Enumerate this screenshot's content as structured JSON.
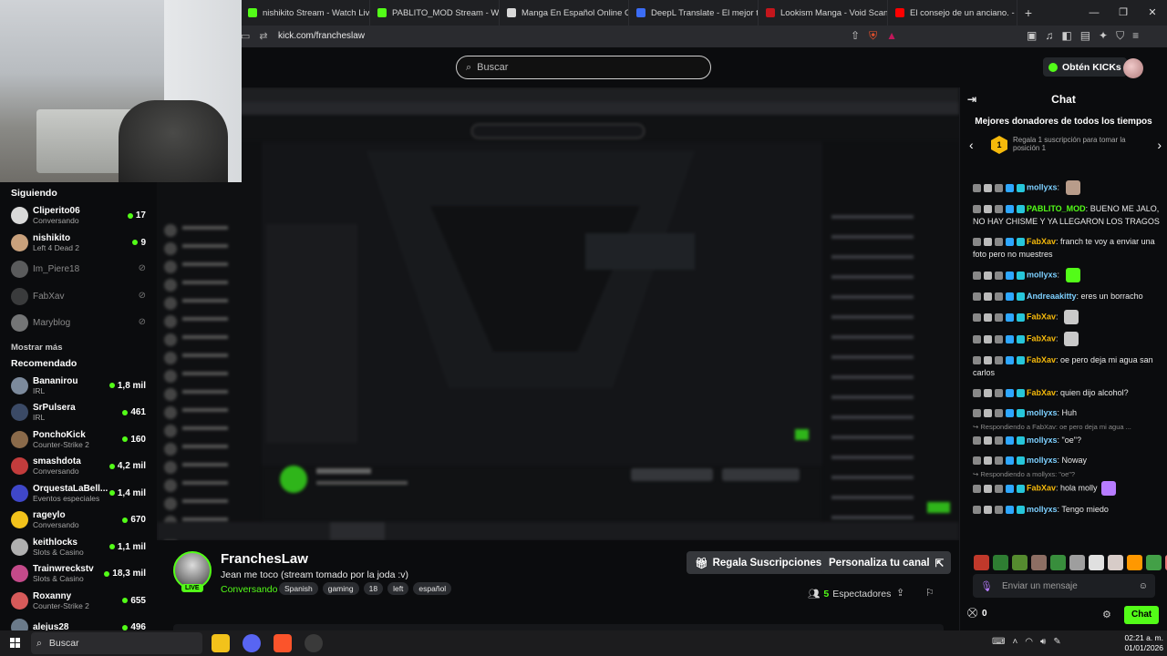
{
  "browser": {
    "tabs": [
      {
        "label": "nishikito Stream - Watch Live o",
        "color": "#53fc18"
      },
      {
        "label": "PABLITO_MOD Stream - Watch",
        "color": "#53fc18"
      },
      {
        "label": "Manga En Español Online Grat",
        "color": "#d8d8d8"
      },
      {
        "label": "DeepL Translate - El mejor trad",
        "color": "#3b6cf5"
      },
      {
        "label": "Lookism Manga - Void Scans h",
        "color": "#c4161c"
      },
      {
        "label": "El consejo de un anciano. - You",
        "color": "#ff0000"
      }
    ],
    "url": "kick.com/francheslaw"
  },
  "header": {
    "search_placeholder": "Buscar",
    "kicks_label": "Obtén KICKs"
  },
  "sidebar": {
    "following_title": "Siguiendo",
    "following": [
      {
        "name": "Cliperito06",
        "category": "Conversando",
        "viewers": "17",
        "live": true,
        "color": "#d9d9d9"
      },
      {
        "name": "nishikito",
        "category": "Left 4 Dead 2",
        "viewers": "9",
        "live": true,
        "color": "#c9a17c"
      },
      {
        "name": "Im_Piere18",
        "category": "",
        "viewers": "",
        "live": false,
        "color": "#aaaaaa"
      },
      {
        "name": "FabXav",
        "category": "",
        "viewers": "",
        "live": false,
        "color": "#6a6a6a"
      },
      {
        "name": "Maryblog",
        "category": "",
        "viewers": "",
        "live": false,
        "color": "#dddddd"
      }
    ],
    "show_more": "Mostrar más",
    "recommended_title": "Recomendado",
    "recommended": [
      {
        "name": "Bananirou",
        "category": "IRL",
        "viewers": "1,8 mil",
        "color": "#7c8a9c"
      },
      {
        "name": "SrPulsera",
        "category": "IRL",
        "viewers": "461",
        "color": "#3b4a66"
      },
      {
        "name": "PonchoKick",
        "category": "Counter-Strike 2",
        "viewers": "160",
        "color": "#8a6a4a"
      },
      {
        "name": "smashdota",
        "category": "Conversando",
        "viewers": "4,2 mil",
        "color": "#c23c3c"
      },
      {
        "name": "OrquestaLaBell...",
        "category": "Eventos especiales",
        "viewers": "1,4 mil",
        "color": "#3f47c9"
      },
      {
        "name": "rageylo",
        "category": "Conversando",
        "viewers": "670",
        "color": "#f2c21b"
      },
      {
        "name": "keithlocks",
        "category": "Slots & Casino",
        "viewers": "1,1 mil",
        "color": "#b0b0b0"
      },
      {
        "name": "Trainwreckstv",
        "category": "Slots & Casino",
        "viewers": "18,3 mil",
        "color": "#c44a8a"
      },
      {
        "name": "Roxanny",
        "category": "Counter-Strike 2",
        "viewers": "655",
        "color": "#d65a5a"
      },
      {
        "name": "alejus28",
        "category": "",
        "viewers": "496",
        "color": "#6a7a8a"
      }
    ]
  },
  "stream": {
    "name": "FranchesLaw",
    "title": "Jean me toco (stream tomado por la joda :v)",
    "category": "Conversando",
    "tags": [
      "Spanish",
      "gaming",
      "18",
      "left",
      "español"
    ],
    "live_label": "LIVE",
    "gift_button": "Regala Suscripciones",
    "customize_button": "Personaliza tu canal",
    "viewers_count": "5",
    "viewers_label": "Espectadores"
  },
  "chat": {
    "title": "Chat",
    "donors_title": "Mejores donadores de todos los tiempos",
    "donor_rank": "1",
    "donor_text": "Regala 1 suscripción para tomar la posición 1",
    "messages": [
      {
        "user": "mollyxs",
        "color": "#7dd0ff",
        "text": "",
        "emote": "#b89c8a"
      },
      {
        "user": "PABLITO_MOD",
        "color": "#53fc18",
        "text": "BUENO ME JALO, NO HAY CHISME Y YA LLEGARON LOS TRAGOS",
        "emote": ""
      },
      {
        "user": "FabXav",
        "color": "#f5b90b",
        "text": "franch te voy a enviar una foto pero no muestres",
        "emote": ""
      },
      {
        "user": "mollyxs",
        "color": "#7dd0ff",
        "text": "",
        "emote": "#53fc18"
      },
      {
        "user": "Andreaakitty",
        "color": "#7dd0ff",
        "text": "eres un borracho",
        "emote": ""
      },
      {
        "user": "FabXav",
        "color": "#f5b90b",
        "text": "",
        "emote": "#c9c9c9"
      },
      {
        "user": "FabXav",
        "color": "#f5b90b",
        "text": "",
        "emote": "#c9c9c9"
      },
      {
        "user": "FabXav",
        "color": "#f5b90b",
        "text": "oe pero deja mi agua san carlos",
        "emote": ""
      },
      {
        "user": "FabXav",
        "color": "#f5b90b",
        "text": "quien dijo alcohol?",
        "emote": ""
      },
      {
        "user": "mollyxs",
        "color": "#7dd0ff",
        "text": "Huh",
        "emote": ""
      },
      {
        "reply": "Respondiendo a FabXav: oe pero deja mi agua ...",
        "user": "mollyxs",
        "color": "#7dd0ff",
        "text": "\"oe\"?",
        "emote": ""
      },
      {
        "user": "mollyxs",
        "color": "#7dd0ff",
        "text": "Noway",
        "emote": ""
      },
      {
        "reply": "Respondiendo a mollyxs: \"oe\"?",
        "user": "FabXav",
        "color": "#f5b90b",
        "text": "hola molly",
        "emote": "#b77cff"
      },
      {
        "user": "mollyxs",
        "color": "#7dd0ff",
        "text": "Tengo miedo",
        "emote": ""
      }
    ],
    "input_placeholder": "Enviar un mensaje",
    "points": "0",
    "send_label": "Chat"
  },
  "taskbar": {
    "search_label": "Buscar",
    "time": "02:21 a. m.",
    "date": "01/01/2026"
  }
}
